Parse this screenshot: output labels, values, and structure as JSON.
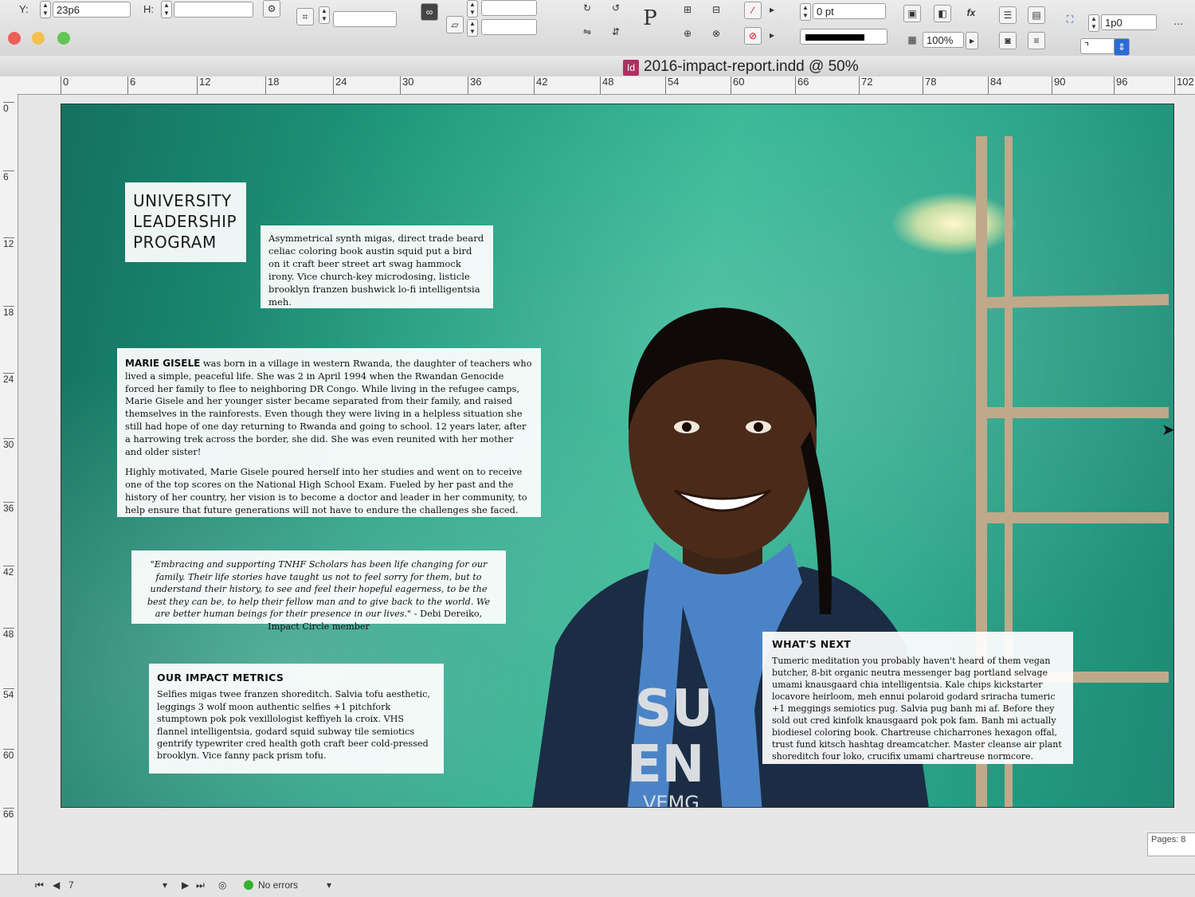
{
  "app": {
    "document_title": "2016-impact-report.indd @ 50%",
    "doc_icon": "Id"
  },
  "control_panel": {
    "y_label": "Y:",
    "y_value": "23p6",
    "h_label": "H:",
    "stroke_weight": "0 pt",
    "opacity": "100%",
    "offset": "1p0",
    "p_icon": "P",
    "fx_icon": "fx"
  },
  "rulers": {
    "horizontal": [
      "0",
      "6",
      "12",
      "18",
      "24",
      "30",
      "36",
      "42",
      "48",
      "54",
      "60",
      "66",
      "72",
      "78",
      "84",
      "90",
      "96",
      "102"
    ],
    "vertical": [
      "0",
      "6",
      "12",
      "18",
      "24",
      "30",
      "36",
      "42",
      "48",
      "54",
      "60",
      "66"
    ]
  },
  "page": {
    "title_lines": [
      "UNIVERSITY",
      "LEADERSHIP",
      "PROGRAM"
    ],
    "intro": "Asymmetrical synth migas, direct trade beard celiac coloring book austin squid put a bird on it craft beer street art swag hammock irony. Vice church-key microdosing, listicle brooklyn franzen bushwick lo-fi intelligentsia meh.",
    "story_name": "MARIE GISELE",
    "story_p1": " was born in a village in western Rwanda, the daughter of teachers who lived a simple, peaceful life. She was 2 in April 1994 when the Rwandan Genocide forced her family to flee to neighboring DR Congo. While living in the refugee camps, Marie Gisele and her younger sister became separated from their family, and raised themselves in the rainforests. Even though they were living in a helpless situation she still had hope of one day returning to Rwanda and going to school. 12 years later, after a harrowing trek across the border, she did. She was even reunited with her mother and older sister!",
    "story_p2": "Highly motivated, Marie Gisele poured herself into her studies and went on to receive one of the top scores on the National High School Exam. Fueled by her past and the history of her country, her vision is to become a doctor and leader in her community, to help ensure that future generations will not have to endure the challenges she faced.",
    "quote": "\"Embracing and supporting TNHF Scholars has been life changing for our family. Their life stories have taught us not to feel sorry for them, but to understand their history, to see and feel their hopeful eagerness, to be the best they can be, to help their fellow man and to give back to the world.  We are better human beings for their presence in our lives.\"",
    "quote_by": " - Debi Dereiko, Impact Circle member",
    "metrics_heading": "OUR IMPACT METRICS",
    "metrics_text": "Selfies migas twee franzen shoreditch. Salvia tofu aesthetic, leggings 3 wolf moon authentic selfies +1 pitchfork stumptown pok pok vexillologist keffiyeh la croix. VHS flannel intelligentsia, godard squid subway tile semiotics gentrify typewriter cred health goth craft beer cold-pressed brooklyn. Vice fanny pack prism tofu.",
    "next_heading": "WHAT'S NEXT",
    "next_text": "Tumeric meditation you probably haven't heard of them vegan butcher, 8-bit organic neutra messenger bag portland selvage umami knausgaard chia intelligentsia. Kale chips kickstarter locavore heirloom, meh ennui polaroid godard sriracha tumeric +1 meggings semiotics pug. Salvia pug banh mi af. Before they sold out cred kinfolk knausgaard pok pok fam. Banh mi actually biodiesel coloring book. Chartreuse chicharrones hexagon offal, trust fund kitsch hashtag dreamcatcher. Master cleanse air plant shoreditch four loko, crucifix umami chartreuse normcore.",
    "shirt_text": [
      "SU",
      "EN",
      "VEMG"
    ]
  },
  "status_bar": {
    "page_number": "7",
    "errors": "No errors",
    "pages_label": "Pages: 8"
  },
  "colors": {
    "page_teal": "#1f9a7d",
    "close": "#ec5f56",
    "minimize": "#f5be4f",
    "zoom": "#62c554",
    "no_errors_dot": "#35b12f"
  }
}
